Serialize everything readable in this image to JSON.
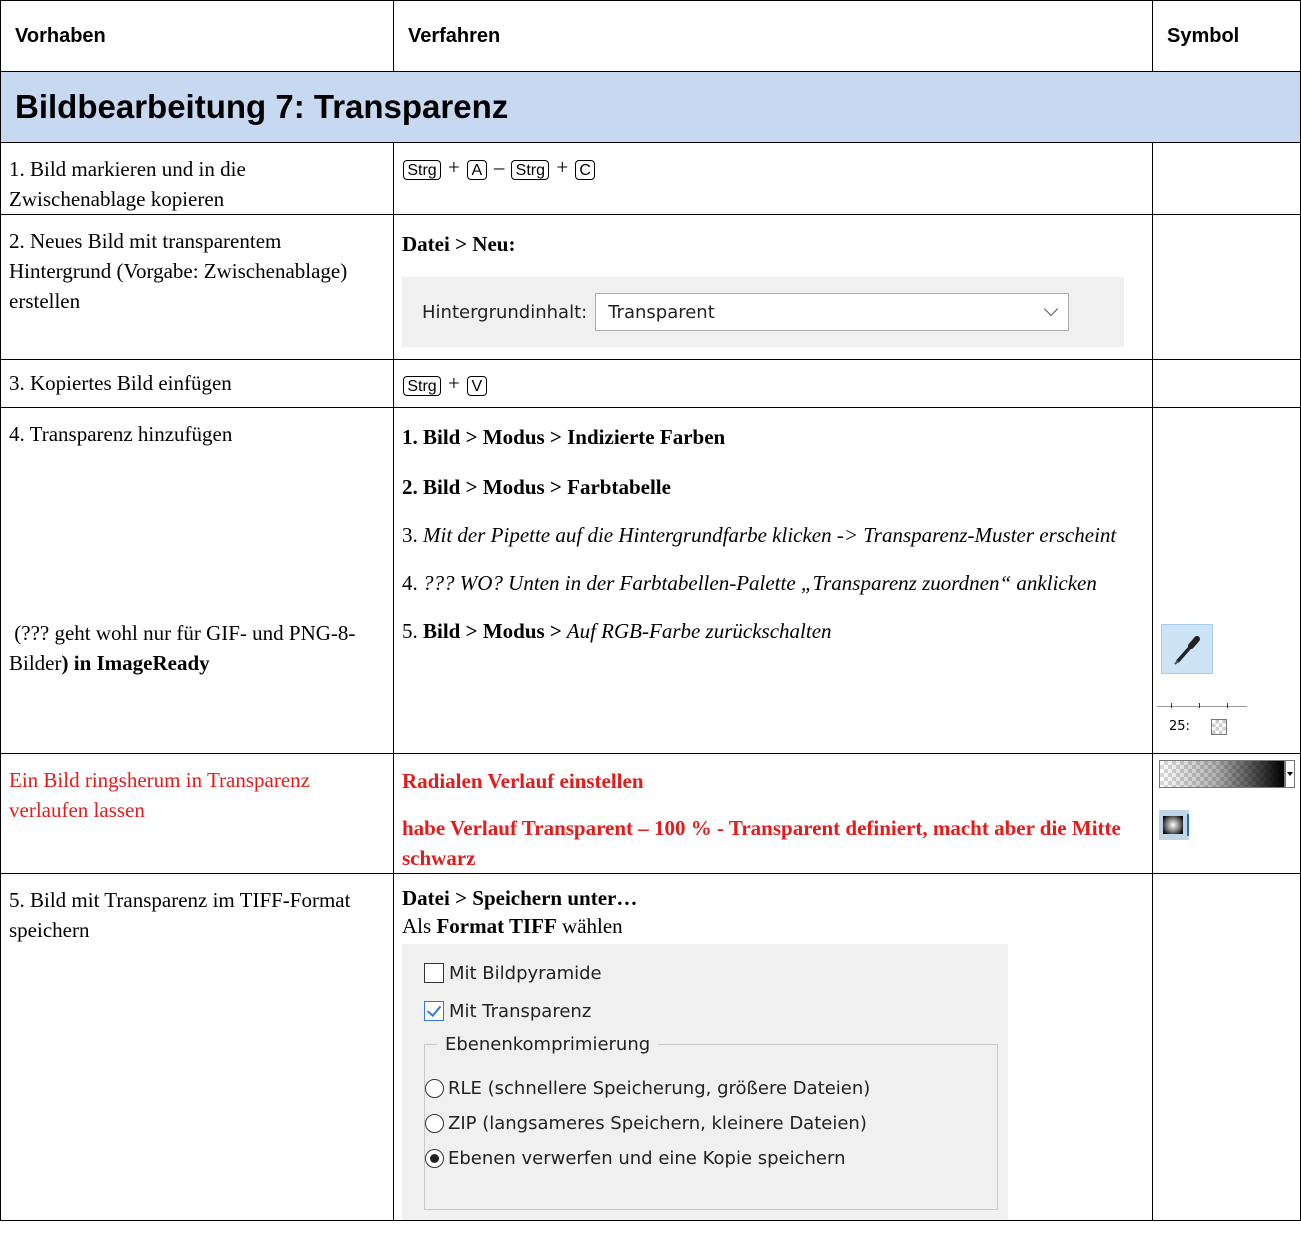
{
  "headers": {
    "col1": "Vorhaben",
    "col2": "Verfahren",
    "col3": "Symbol"
  },
  "section_title": "Bildbearbeitung 7: Transparenz",
  "rows": {
    "r1": {
      "task": "1. Bild markieren und in die Zwischenablage kopieren",
      "keys": {
        "k1": "Strg",
        "plus1": "+",
        "k2": "A",
        "dash": "–",
        "k3": "Strg",
        "plus2": "+",
        "k4": "C"
      }
    },
    "r2": {
      "task": "2. Neues Bild mit transparentem Hintergrund (Vorgabe: Zwischenablage) erstellen",
      "method": "Datei > Neu:",
      "dialog_label": "Hintergrundinhalt:",
      "dialog_value": "Transparent"
    },
    "r3": {
      "task": "3. Kopiertes Bild einfügen",
      "keys": {
        "k1": "Strg",
        "plus": "+",
        "k2": "V"
      }
    },
    "r4": {
      "task": "4. Transparenz hinzufügen",
      "note_a": "(??? geht wohl nur für GIF- und PNG-8-Bilder",
      "note_b": ") in ImageReady",
      "steps": {
        "s1": "1. Bild > Modus > Indizierte Farben",
        "s2": "2. Bild > Modus > Farbtabelle",
        "s3_num": "3. ",
        "s3_text": "Mit der Pipette auf die Hintergrundfarbe klicken -> Transparenz-Muster erscheint",
        "s4_num": "4. ",
        "s4_text": "??? WO? Unten in der Farbtabellen-Palette „Transparenz zuordnen“ anklicken",
        "s5_num": "5. ",
        "s5_bold": "Bild > Modus >",
        "s5_italic": " Auf RGB-Farbe zurückschalten"
      },
      "symbols": {
        "pipette": "eyedropper-icon",
        "ruler_value": "25:"
      }
    },
    "r5": {
      "task": "Ein Bild ringsherum in Transparenz verlaufen lassen",
      "m1": "Radialen Verlauf einstellen",
      "m2": "habe Verlauf Transparent – 100 % - Transparent definiert, macht aber die Mitte schwarz",
      "symbols": {
        "gradient": "gradient-picker-icon",
        "radial": "radial-gradient-icon"
      }
    },
    "r6": {
      "task": "5. Bild mit Transparenz im TIFF-Format speichern",
      "m1": "Datei > Speichern unter…",
      "m2_pre": "Als ",
      "m2_bold": "Format TIFF",
      "m2_post": " wählen",
      "dialog": {
        "cb1": "Mit Bildpyramide",
        "cb2": "Mit Transparenz",
        "group": "Ebenenkomprimierung",
        "rb1": "RLE (schnellere Speicherung, größere Dateien)",
        "rb2": "ZIP (langsameres Speichern, kleinere Dateien)",
        "rb3": "Ebenen verwerfen und eine Kopie speichern"
      }
    }
  },
  "colors": {
    "section_bg": "#c6d9f0",
    "red_text": "#e41b1b",
    "accent_checkbox": "#2e7bd6"
  }
}
